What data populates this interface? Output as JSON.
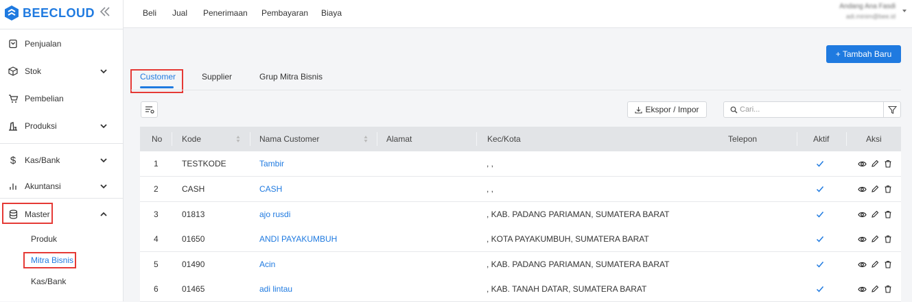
{
  "brand": {
    "name": "BEECLOUD",
    "color": "#1f7ae0"
  },
  "sidebar": {
    "items": [
      {
        "label": "Penjualan",
        "icon": "receipt-icon"
      },
      {
        "label": "Stok",
        "icon": "box-icon"
      },
      {
        "label": "Pembelian",
        "icon": "cart-icon"
      },
      {
        "label": "Produksi",
        "icon": "factory-icon"
      },
      {
        "label": "Kas/Bank",
        "icon": "dollar-icon"
      },
      {
        "label": "Akuntansi",
        "icon": "bar-chart-icon"
      },
      {
        "label": "Master",
        "icon": "database-icon"
      }
    ],
    "sub_items": [
      "Produk",
      "Mitra Bisnis",
      "Kas/Bank"
    ]
  },
  "topnav": [
    "Beli",
    "Jual",
    "Penerimaan",
    "Pembayaran",
    "Biaya"
  ],
  "user": {
    "name": "Andang Ana Fasdi",
    "email": "adi.minim@bee.id"
  },
  "add_button": "+ Tambah Baru",
  "tabs": [
    "Customer",
    "Supplier",
    "Grup Mitra Bisnis"
  ],
  "toolbar": {
    "export_label": "Ekspor / Impor",
    "search_placeholder": "Cari..."
  },
  "table": {
    "headers": [
      "No",
      "Kode",
      "Nama Customer",
      "Alamat",
      "Kec/Kota",
      "Telepon",
      "Aktif",
      "Aksi"
    ],
    "rows": [
      {
        "no": "1",
        "kode": "TESTKODE",
        "nama": "Tambir",
        "alamat": "",
        "kota": ", ,",
        "telepon": ""
      },
      {
        "no": "2",
        "kode": "CASH",
        "nama": "CASH",
        "alamat": "",
        "kota": ", ,",
        "telepon": ""
      },
      {
        "no": "3",
        "kode": "01813",
        "nama": "ajo rusdi",
        "alamat": "",
        "kota": ", KAB. PADANG PARIAMAN, SUMATERA BARAT",
        "telepon": ""
      },
      {
        "no": "4",
        "kode": "01650",
        "nama": "ANDI PAYAKUMBUH",
        "alamat": "",
        "kota": ", KOTA PAYAKUMBUH, SUMATERA BARAT",
        "telepon": ""
      },
      {
        "no": "5",
        "kode": "01490",
        "nama": "Acin",
        "alamat": "",
        "kota": ", KAB. PADANG PARIAMAN, SUMATERA BARAT",
        "telepon": ""
      },
      {
        "no": "6",
        "kode": "01465",
        "nama": "adi lintau",
        "alamat": "",
        "kota": ", KAB. TANAH DATAR, SUMATERA BARAT",
        "telepon": ""
      }
    ]
  }
}
